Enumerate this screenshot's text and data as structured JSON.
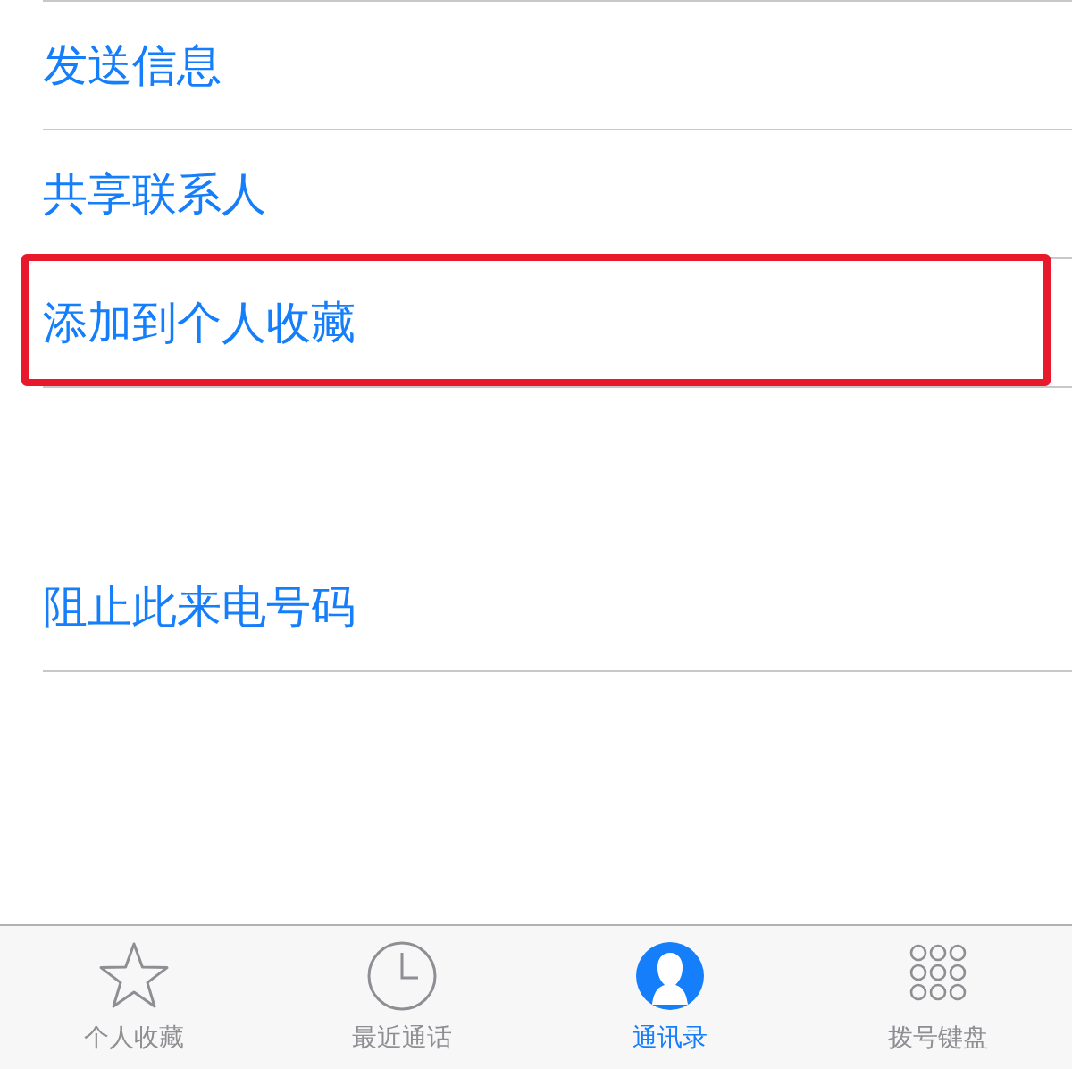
{
  "sections": [
    {
      "items": [
        {
          "label": "发送信息",
          "highlighted": false
        },
        {
          "label": "共享联系人",
          "highlighted": false
        },
        {
          "label": "添加到个人收藏",
          "highlighted": true
        }
      ]
    },
    {
      "items": [
        {
          "label": "阻止此来电号码",
          "highlighted": false
        }
      ]
    }
  ],
  "tabs": [
    {
      "kind": "star",
      "label": "个人收藏",
      "selected": false
    },
    {
      "kind": "clock",
      "label": "最近通话",
      "selected": false
    },
    {
      "kind": "person",
      "label": "通讯录",
      "selected": true
    },
    {
      "kind": "keypad",
      "label": "拨号键盘",
      "selected": false
    }
  ]
}
